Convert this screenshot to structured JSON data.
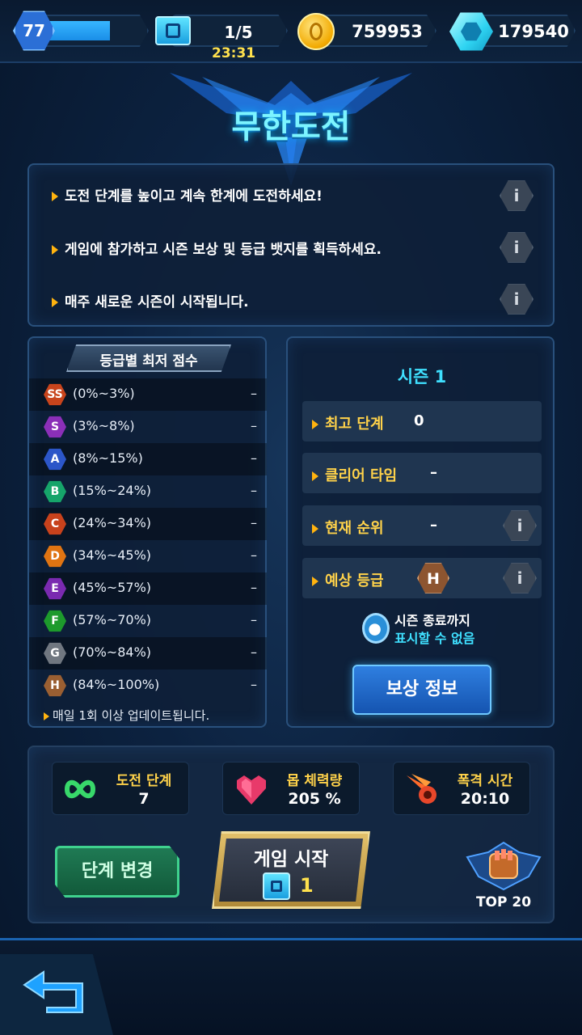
{
  "topbar": {
    "level": "77",
    "tickets": "1/5",
    "ticket_timer": "23:31",
    "gold": "759953",
    "gems": "179540"
  },
  "title": "무한도전",
  "notices": [
    {
      "text": "도전 단계를 높이고 계속 한계에 도전하세요!"
    },
    {
      "text": "게임에 참가하고 시즌 보상 및 등급 뱃지를 획득하세요."
    },
    {
      "text": "매주 새로운 시즌이 시작됩니다."
    }
  ],
  "info_symbol": "i",
  "grades": {
    "header": "등급별 최저 점수",
    "rows": [
      {
        "badge": "SS",
        "range": "(0%~3%)",
        "value": "–",
        "color": "#c8441c"
      },
      {
        "badge": "S",
        "range": "(3%~8%)",
        "value": "–",
        "color": "#8b2fb8"
      },
      {
        "badge": "A",
        "range": "(8%~15%)",
        "value": "–",
        "color": "#2c56c8"
      },
      {
        "badge": "B",
        "range": "(15%~24%)",
        "value": "–",
        "color": "#16a46a"
      },
      {
        "badge": "C",
        "range": "(24%~34%)",
        "value": "–",
        "color": "#c8421c"
      },
      {
        "badge": "D",
        "range": "(34%~45%)",
        "value": "–",
        "color": "#e07412"
      },
      {
        "badge": "E",
        "range": "(45%~57%)",
        "value": "–",
        "color": "#7a2ab0"
      },
      {
        "badge": "F",
        "range": "(57%~70%)",
        "value": "–",
        "color": "#1d9a2c"
      },
      {
        "badge": "G",
        "range": "(70%~84%)",
        "value": "–",
        "color": "#707780"
      },
      {
        "badge": "H",
        "range": "(84%~100%)",
        "value": "–",
        "color": "#9a5f32"
      }
    ],
    "footnote": "매일 1회 이상 업데이트됩니다."
  },
  "season": {
    "title": "시즌 1",
    "best_stage_label": "최고 단계",
    "best_stage_value": "0",
    "clear_time_label": "클리어 타임",
    "clear_time_value": "–",
    "rank_label": "현재 순위",
    "rank_value": "–",
    "expected_grade_label": "예상 등급",
    "expected_grade_badge": "H",
    "end_line1": "시즌 종료까지",
    "end_line2": "표시할 수 없음",
    "reward_button": "보상 정보"
  },
  "stats": [
    {
      "label": "도전 단계",
      "value": "7",
      "icon": "infinity-icon"
    },
    {
      "label": "몹 체력량",
      "value": "205 %",
      "icon": "heart-icon"
    },
    {
      "label": "폭격 시간",
      "value": "20:10",
      "icon": "meteor-icon"
    }
  ],
  "change_stage_button": "단계 변경",
  "start_button": {
    "label": "게임 시작",
    "cost": "1"
  },
  "top_badge": "TOP 20",
  "colors": {
    "accent_cyan": "#3fe0ff",
    "gold": "#ffd24a",
    "start_button": "#c9a24a"
  }
}
